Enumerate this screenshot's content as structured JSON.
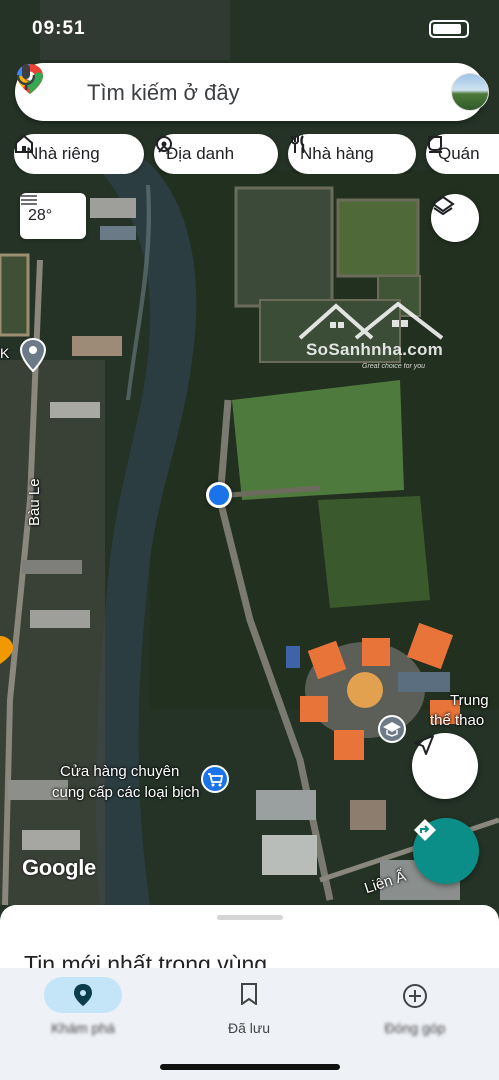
{
  "status_bar": {
    "time": "09:51"
  },
  "search": {
    "placeholder": "Tìm kiếm ở đây"
  },
  "chips": [
    {
      "label": "Nhà riêng",
      "icon": "home-icon"
    },
    {
      "label": "Địa danh",
      "icon": "landmark-icon"
    },
    {
      "label": "Nhà hàng",
      "icon": "restaurant-icon"
    },
    {
      "label": "Quán",
      "icon": "coffee-icon"
    }
  ],
  "weather": {
    "temperature": "28°"
  },
  "watermark": {
    "brand": "SoSanhnha.com",
    "tagline": "Great choice for you"
  },
  "map_labels": {
    "road_bau_le": "Bàu Le",
    "pin_k": "K",
    "trung": "Trung",
    "the_thao": "thể thao",
    "shop_line1": "Cửa hàng chuyên",
    "shop_line2": "cung cấp các loại bịch",
    "road_lien": "Liên Ấ"
  },
  "map_attribution": "Google",
  "sheet": {
    "title": "Tin mới nhất trong vùng"
  },
  "bottom_nav": [
    {
      "label": "Khám phá",
      "icon": "explore-pin-icon",
      "active": true
    },
    {
      "label": "Đã lưu",
      "icon": "bookmark-icon",
      "active": false
    },
    {
      "label": "Đóng góp",
      "icon": "add-circle-icon",
      "active": false
    }
  ],
  "colors": {
    "accent": "#0b8e87",
    "location_dot": "#1a73e8",
    "nav_active": "#c4e5f7"
  }
}
